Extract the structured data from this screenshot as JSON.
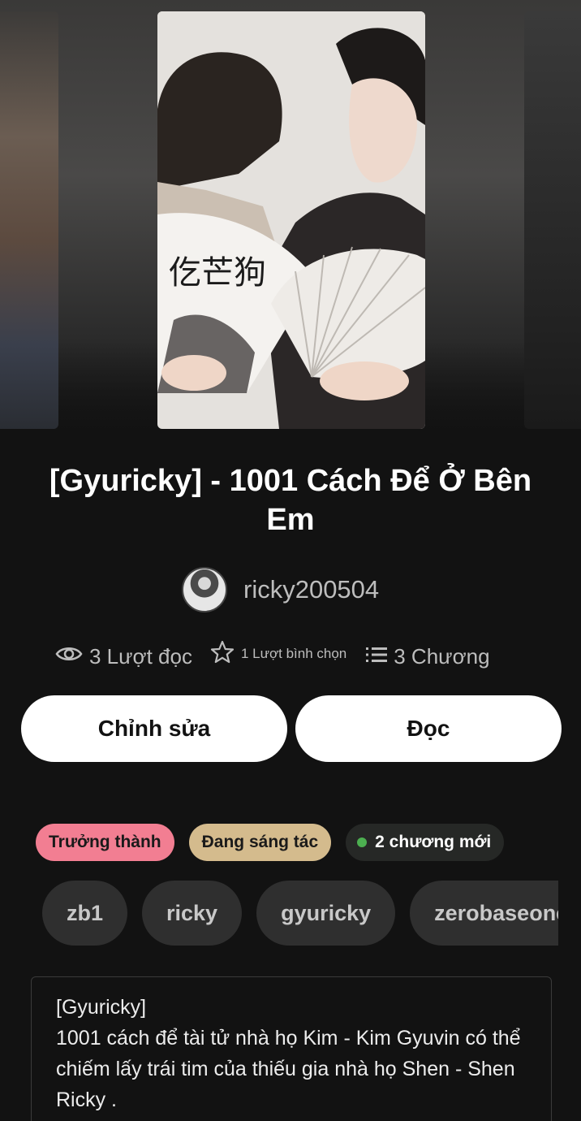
{
  "story": {
    "title": "[Gyuricky] - 1001 Cách Để Ở Bên Em",
    "author": "ricky200504"
  },
  "stats": {
    "reads": "3 Lượt đọc",
    "votes": "1 Lượt bình chọn",
    "parts": "3 Chương",
    "reads_icon": "eye-icon",
    "votes_icon": "star-icon",
    "parts_icon": "list-icon"
  },
  "actions": {
    "edit_label": "Chỉnh sửa",
    "read_label": "Đọc"
  },
  "badges": {
    "mature": "Trưởng thành",
    "ongoing": "Đang sáng tác",
    "new_parts": "2 chương mới"
  },
  "tags": [
    "zb1",
    "ricky",
    "gyuricky",
    "zerobaseone"
  ],
  "description": "[Gyuricky]\n1001 cách để tài tử nhà họ Kim - Kim Gyuvin có thể chiếm lấy trái tim của thiếu gia nhà họ Shen - Shen Ricky .",
  "colors": {
    "background": "#121212",
    "button_bg": "#ffffff",
    "badge_mature": "#f27e92",
    "badge_ongoing": "#d4bb8d",
    "badge_new_dot": "#4caf50",
    "tag_bg": "#2f2f2f"
  }
}
